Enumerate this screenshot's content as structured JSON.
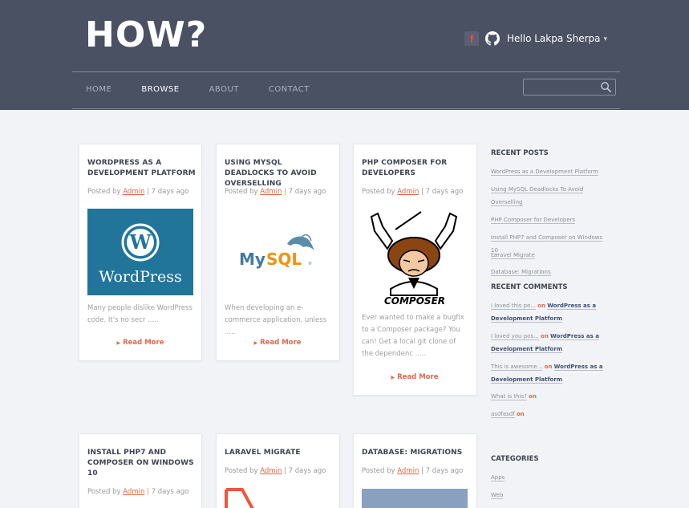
{
  "header": {
    "logo": "HOW?",
    "facebook_glyph": "f",
    "user_greeting": "Hello Lakpa Sherpa",
    "user_caret": "▾"
  },
  "nav": {
    "items": [
      "HOME",
      "BROWSE",
      "ABOUT",
      "CONTACT"
    ],
    "active": "BROWSE"
  },
  "search": {
    "placeholder": ""
  },
  "posts": [
    {
      "title": "WORDPRESS AS A DEVELOPMENT PLATFORM",
      "posted_by": "Posted by",
      "author": "Admin",
      "date": "| 7 days ago",
      "image_text": "WordPress",
      "excerpt": "Many people dislike WordPress code. It's no secr .....",
      "read_more": "Read More"
    },
    {
      "title": "USING MYSQL DEADLOCKS TO AVOID OVERSELLING",
      "posted_by": "Posted by",
      "author": "Admin",
      "date": "| 7 days ago",
      "image_text": "MySQL",
      "excerpt": "When developing an e-commerce application, unless .....",
      "read_more": "Read More"
    },
    {
      "title": "PHP COMPOSER FOR DEVELOPERS",
      "posted_by": "Posted by",
      "author": "Admin",
      "date": "| 7 days ago",
      "image_text": "COMPOSER",
      "excerpt": "Ever wanted to make a bugfix to a Composer package? You can! Get a local git clone of the dependenc .....",
      "read_more": "Read More"
    },
    {
      "title": "INSTALL PHP7 AND COMPOSER ON WINDOWS 10",
      "posted_by": "Posted by",
      "author": "Admin",
      "date": "| 7 days ago"
    },
    {
      "title": "LARAVEL MIGRATE",
      "posted_by": "Posted by",
      "author": "Admin",
      "date": "| 7 days ago"
    },
    {
      "title": "DATABASE: MIGRATIONS",
      "posted_by": "Posted by",
      "author": "Admin",
      "date": "| 7 days ago"
    }
  ],
  "sidebar": {
    "recent_posts_heading": "RECENT POSTS",
    "recent_posts": [
      "WordPress as a Development Platform",
      "Using MySQL Deadlocks To Avoid Overselling",
      "PHP Composer for Developers",
      "Install PHP7 and Composer on Windows 10",
      "Laravel Migrate",
      "Database: Migrations"
    ],
    "recent_comments_heading": "RECENT COMMENTS",
    "recent_comments": [
      {
        "text": "I loved this po...",
        "on": "on",
        "post": "WordPress as a Development Platform"
      },
      {
        "text": "I loved you pos...",
        "on": "on",
        "post": "WordPress as a Development Platform"
      },
      {
        "text": "This is awesome...",
        "on": "on",
        "post": "WordPress as a Development Platform"
      },
      {
        "text": "What is this?",
        "on": "on",
        "post": ""
      },
      {
        "text": "asdfasdf",
        "on": "on",
        "post": ""
      }
    ],
    "categories_heading": "CATEGORIES",
    "categories": [
      "Apps",
      "Web"
    ]
  },
  "colors": {
    "header_bg": "#4a5163",
    "page_bg": "#f1f3f6",
    "accent": "#e2674b",
    "heading": "#3e4452"
  }
}
